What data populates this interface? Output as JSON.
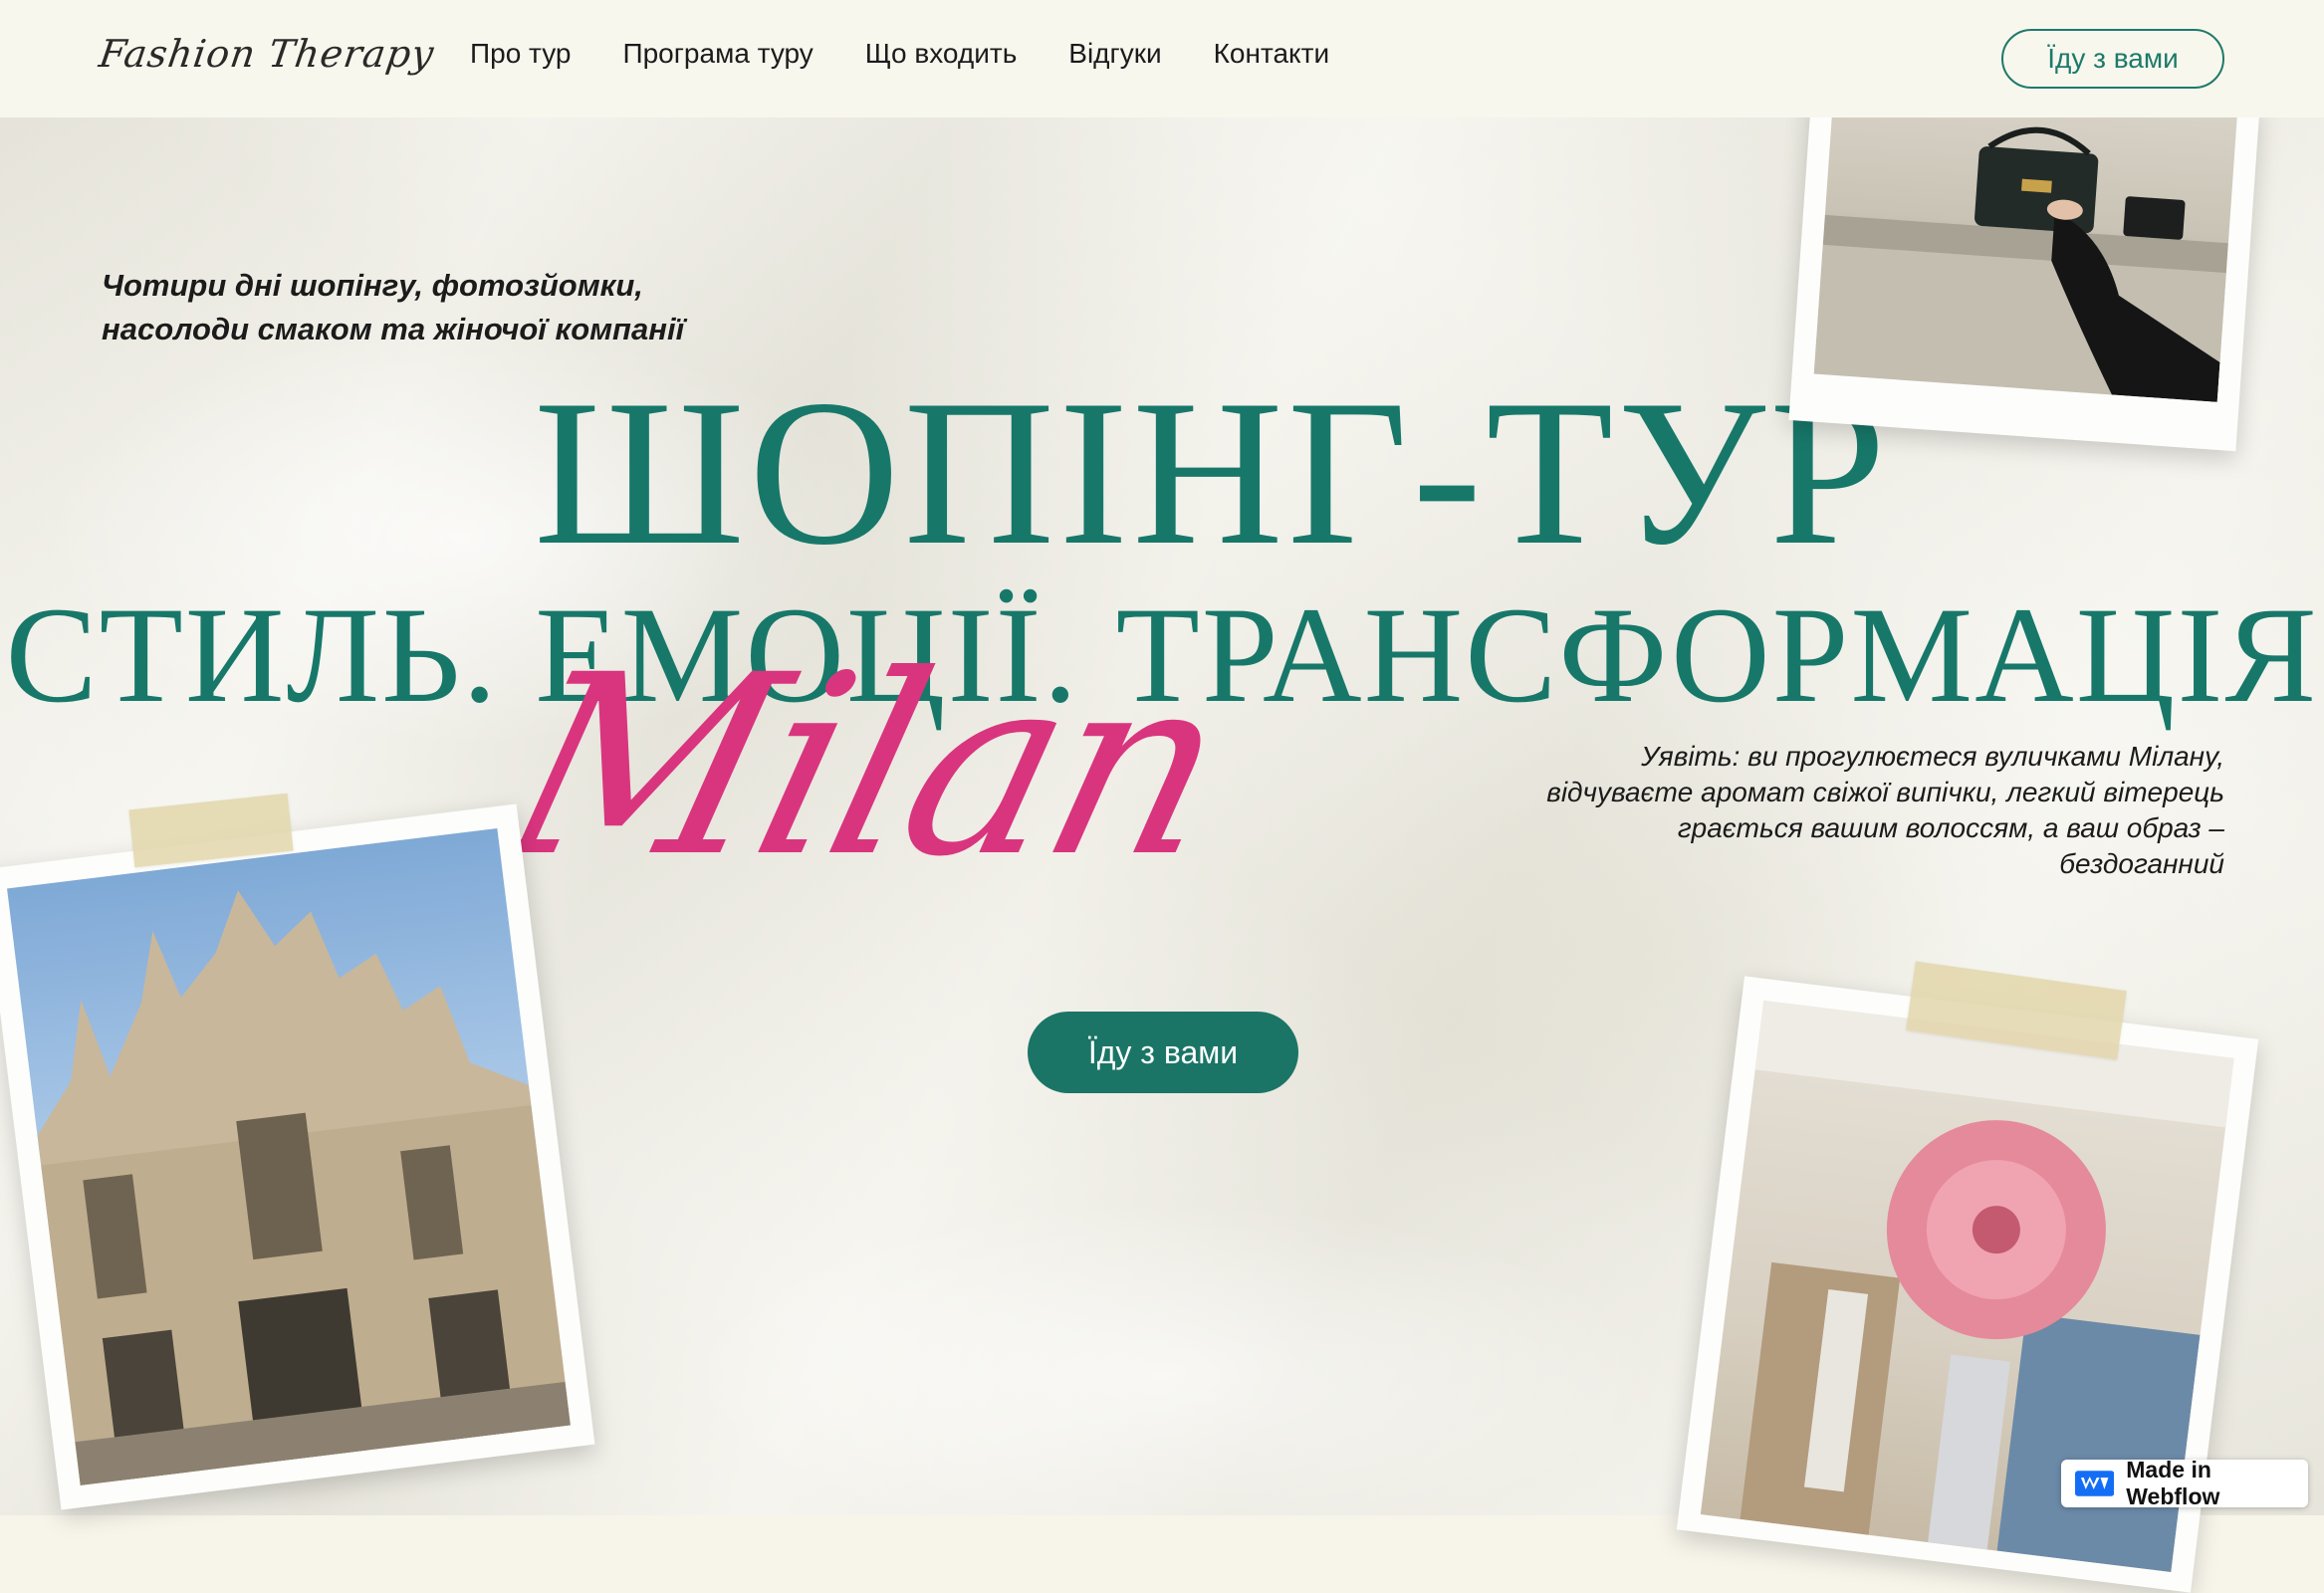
{
  "header": {
    "logo": "Fashion Therapy",
    "nav": [
      "Про тур",
      "Програма туру",
      "Що входить",
      "Відгуки",
      "Контакти"
    ],
    "cta": "Їду з вами"
  },
  "hero": {
    "intro": "Чотири дні шопінгу, фотозйомки, насолоди смаком та жіночої компанії",
    "title_line1": "ШОПІНГ-ТУР",
    "title_line2": "СТИЛЬ. ЕМОЦІЇ. ТРАНСФОРМАЦІЯ",
    "script_word": "Milan",
    "description": "Уявіть: ви прогулюєтеся вуличками Мілану, відчуваєте аромат свіжої випічки, легкий вітерець грається вашим волоссям, а ваш образ – бездоганний",
    "cta": "Їду з вами"
  },
  "badge": {
    "label": "Made in Webflow"
  },
  "colors": {
    "accent": "#17786a",
    "script": "#d9357f",
    "background": "#f7f5ea"
  }
}
